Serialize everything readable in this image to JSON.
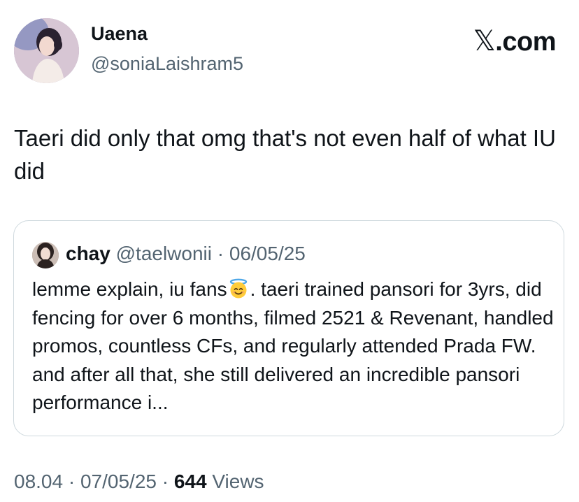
{
  "author": {
    "display_name": "Uaena",
    "handle": "@soniaLaishram5"
  },
  "brand": {
    "x_glyph": "𝕏",
    "domain": ".com"
  },
  "tweet": {
    "text": "Taeri did only that omg that's not even half of what IU did"
  },
  "quote": {
    "name": "chay",
    "handle": "@taelwonii",
    "separator": " · ",
    "date": "06/05/25",
    "text_before_emoji": "lemme explain, iu fans",
    "emoji": "smiling-face-with-halo",
    "text_after_emoji": ". taeri trained pansori for 3yrs, did fencing for over 6 months, filmed 2521 & Revenant, handled promos, countless CFs, and regularly attended Prada FW. and after all that, she still delivered an incredible pansori performance i..."
  },
  "footer": {
    "time": "08.04",
    "separator": " · ",
    "date": "07/05/25",
    "views_count": "644",
    "views_label": " Views"
  }
}
